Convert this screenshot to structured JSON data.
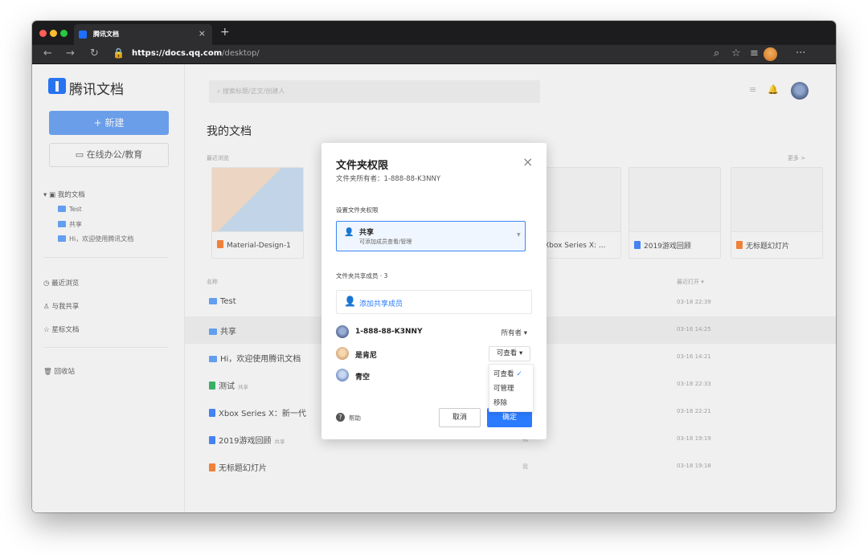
{
  "browser": {
    "tab_title": "腾讯文档",
    "tab_close": "×",
    "new_tab": "+",
    "url_scheme_host": "https://docs.qq.com",
    "url_path": "/desktop/"
  },
  "sidebar": {
    "logo_text": "腾讯文档",
    "new_button": "+ 新建",
    "office_button": "在线办公/教育",
    "my_docs": "我的文档",
    "folders": [
      "Test",
      "共享",
      "Hi，欢迎使用腾讯文档"
    ],
    "recent": "最近浏览",
    "shared_with_me": "与我共享",
    "starred": "星标文档",
    "trash": "回收站"
  },
  "main": {
    "search_placeholder": "搜索标题/正文/创建人",
    "title": "我的文档",
    "recent_label": "最近浏览",
    "more_link": "更多 >",
    "recent_cards": [
      {
        "name": "Material-Design-1",
        "icon": "slides-icon",
        "color": "orange"
      },
      {
        "name": "Xbox Series X: ...",
        "icon": "doc-icon",
        "color": "blue"
      },
      {
        "name": "2019游戏回顾",
        "icon": "doc-icon",
        "color": "blue"
      },
      {
        "name": "无标题幻灯片",
        "icon": "slides-icon",
        "color": "orange"
      }
    ],
    "columns": {
      "name": "名称",
      "last_opened": "最近打开 ▾"
    },
    "rows": [
      {
        "name": "Test",
        "tag": "",
        "owner": "",
        "date": "03-18 22:39",
        "icon": "folder-icon"
      },
      {
        "name": "共享",
        "tag": "",
        "owner": "",
        "date": "03-16 14:25",
        "icon": "shared-folder-icon"
      },
      {
        "name": "Hi，欢迎使用腾讯文档",
        "tag": "",
        "owner": "",
        "date": "03-16 14:21",
        "icon": "folder-icon"
      },
      {
        "name": "测试",
        "tag": "共享",
        "owner": "",
        "date": "03-18 22:33",
        "icon": "sheet-icon"
      },
      {
        "name": "Xbox Series X：新一代",
        "tag": "",
        "owner": "",
        "date": "03-18 22:21",
        "icon": "doc-icon"
      },
      {
        "name": "2019游戏回顾",
        "tag": "共享",
        "owner": "我",
        "date": "03-18 19:19",
        "icon": "doc-icon"
      },
      {
        "name": "无标题幻灯片",
        "tag": "",
        "owner": "我",
        "date": "03-18 19:18",
        "icon": "slides-icon"
      }
    ]
  },
  "dialog": {
    "title": "文件夹权限",
    "close": "×",
    "owner_line": "文件夹所有者：1-888-88-K3NNY",
    "set_permission_label": "设置文件夹权限",
    "permission_title": "共享",
    "permission_desc": "可添加成员查看/管理",
    "members_label": "文件夹共享成员 · 3",
    "add_member": "添加共享成员",
    "members": [
      {
        "name": "1-888-88-K3NNY",
        "role": "所有者 ▾"
      },
      {
        "name": "是肯尼",
        "role": "可查看 ▾"
      },
      {
        "name": "青空",
        "role": ""
      }
    ],
    "role_menu": {
      "options": [
        "可查看",
        "可管理",
        "移除"
      ],
      "check": "✓"
    },
    "help": "帮助",
    "cancel": "取消",
    "confirm": "确定"
  }
}
